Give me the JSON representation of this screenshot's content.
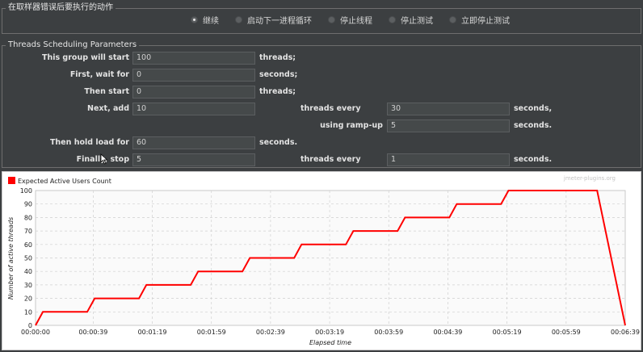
{
  "error_action": {
    "legend": "在取样器错误后要执行的动作",
    "options": [
      {
        "label": "继续",
        "selected": true
      },
      {
        "label": "启动下一进程循环",
        "selected": false
      },
      {
        "label": "停止线程",
        "selected": false
      },
      {
        "label": "停止测试",
        "selected": false
      },
      {
        "label": "立即停止测试",
        "selected": false
      }
    ]
  },
  "threads": {
    "legend": "Threads Scheduling Parameters",
    "start_label": "This group will start",
    "start_value": "100",
    "start_unit": "threads;",
    "wait_label": "First, wait for",
    "wait_value": "0",
    "wait_unit": "seconds;",
    "then_start_label": "Then start",
    "then_start_value": "0",
    "then_start_unit": "threads;",
    "next_add_label": "Next, add",
    "next_add_value": "10",
    "every_label": "threads every",
    "every_value": "30",
    "every_unit": "seconds,",
    "rampup_label": "using ramp-up",
    "rampup_value": "5",
    "rampup_unit": "seconds.",
    "hold_label": "Then hold load for",
    "hold_value": "60",
    "hold_unit": "seconds.",
    "stop_label": "Finally, stop",
    "stop_value": "5",
    "stop_every_label": "threads every",
    "stop_every_value": "1",
    "stop_unit": "seconds."
  },
  "chart_data": {
    "type": "line",
    "watermark": "jmeter-plugins.org",
    "legend": "Expected Active Users Count",
    "ylabel": "Number of active threads",
    "xlabel": "Elapsed time",
    "ylim": [
      0,
      100
    ],
    "y_ticks": [
      0,
      10,
      20,
      30,
      40,
      50,
      60,
      70,
      80,
      90,
      100
    ],
    "x_range_seconds": [
      0,
      399
    ],
    "x_ticks": [
      {
        "sec": 0,
        "label": "00:00:00"
      },
      {
        "sec": 39,
        "label": "00:00:39"
      },
      {
        "sec": 79,
        "label": "00:01:19"
      },
      {
        "sec": 119,
        "label": "00:01:59"
      },
      {
        "sec": 159,
        "label": "00:02:39"
      },
      {
        "sec": 199,
        "label": "00:03:19"
      },
      {
        "sec": 239,
        "label": "00:03:59"
      },
      {
        "sec": 279,
        "label": "00:04:39"
      },
      {
        "sec": 319,
        "label": "00:05:19"
      },
      {
        "sec": 359,
        "label": "00:05:59"
      },
      {
        "sec": 399,
        "label": "00:06:39"
      }
    ],
    "series": [
      {
        "name": "Expected Active Users Count",
        "color": "#ff0000",
        "points": [
          [
            0,
            0
          ],
          [
            5,
            10
          ],
          [
            35,
            10
          ],
          [
            40,
            20
          ],
          [
            70,
            20
          ],
          [
            75,
            30
          ],
          [
            105,
            30
          ],
          [
            110,
            40
          ],
          [
            140,
            40
          ],
          [
            145,
            50
          ],
          [
            175,
            50
          ],
          [
            180,
            60
          ],
          [
            210,
            60
          ],
          [
            215,
            70
          ],
          [
            245,
            70
          ],
          [
            250,
            80
          ],
          [
            280,
            80
          ],
          [
            285,
            90
          ],
          [
            315,
            90
          ],
          [
            320,
            100
          ],
          [
            380,
            100
          ],
          [
            399,
            0
          ]
        ]
      }
    ]
  }
}
